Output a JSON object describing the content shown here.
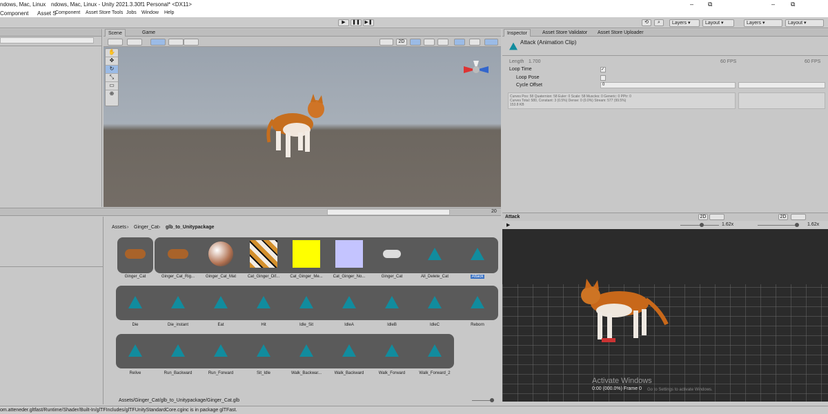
{
  "window": {
    "title_left": "ndows, Mac, Linux",
    "title_left2": "ndows, Mac, Linux - Unity 2021.3.30f1 Personal* <DX11>",
    "minimize": "–",
    "restore": "⧉"
  },
  "menu": {
    "items": [
      "Component",
      "Asset S",
      "Component",
      "Asset Store Tools",
      "Jobs",
      "Window",
      "Help"
    ]
  },
  "toolbar": {
    "play": "▶",
    "pause": "❚❚",
    "step": "▶❚",
    "history": "⟲",
    "search": "⌕",
    "layers": "Layers",
    "layout": "Layout",
    "layers2": "Layers",
    "layout2": "Layout"
  },
  "scene_tabs": [
    "Scene",
    "Game"
  ],
  "scene_toolbar": {
    "mode_2d": "2D",
    "gizmo_count": ""
  },
  "inspector": {
    "tabs": [
      "Inspector",
      "Asset Store Validator",
      "Asset Store Uploader"
    ],
    "title": "Attack (Animation Clip)",
    "length_label": "Length",
    "length_value": "1.700",
    "fps": "60 FPS",
    "fps2": "60 FPS",
    "loop_time": "Loop Time",
    "loop_pose": "Loop Pose",
    "cycle_offset": "Cycle Offset",
    "cycle_offset_value": "0",
    "curves_info": "Curves Pos: 58 Quaternion: 58 Euler: 0 Scale: 58 Muscles: 0 Generic: 0 PPtr: 0",
    "curves_info2": "Curves Total: 580, Constant: 3 (0.5%) Dense: 0 (0.0%) Stream: 577 (99.5%)",
    "size": "153.8 KB"
  },
  "preview": {
    "title": "Attack",
    "mode_2d": "2D",
    "zoom": "1.62x",
    "zoom2": "1.62x",
    "time": "0:00 (000.0%) Frame 0",
    "watermark": "Activate Windows",
    "watermark2": "Go to Settings to activate Windows."
  },
  "project": {
    "breadcrumb": [
      "Assets",
      "Ginger_Cat",
      "glb_to_Unitypackage"
    ],
    "hidden_count": "20",
    "path_bar": "Assets/Ginger_Cat/glb_to_Unitypackage/Ginger_Cat.glb",
    "row1": [
      "Ginger_Cat",
      "Ginger_Cat_Rig...",
      "Ginger_Cat_Mat",
      "Cat_Ginger_Dif...",
      "Cat_Ginger_Me...",
      "Cat_Ginger_No...",
      "Ginger_Cat",
      "All_Delete_Cat",
      "Attack"
    ],
    "row2": [
      "Die",
      "Die_instant",
      "Eat",
      "Hit",
      "Idle_Sit",
      "IdleA",
      "IdleB",
      "IdleC",
      "Reborn"
    ],
    "row3": [
      "Relive",
      "Run_Backward",
      "Run_Forward",
      "Sit_Idle",
      "Walk_Backwar...",
      "Walk_Backward",
      "Walk_Forward",
      "Walk_Forward_2"
    ]
  },
  "status": {
    "text": "om.atteneder.gltfast/Runtime/Shader/Built-In/glTFIncludes/glTFUnityStandardCore.cginc is in package glTFast."
  },
  "colors": {
    "accent": "#3a72c4",
    "swatch_yellow": "#ffff00",
    "swatch_lavender": "#c4c4ff",
    "anim_icon": "#118c9e"
  }
}
